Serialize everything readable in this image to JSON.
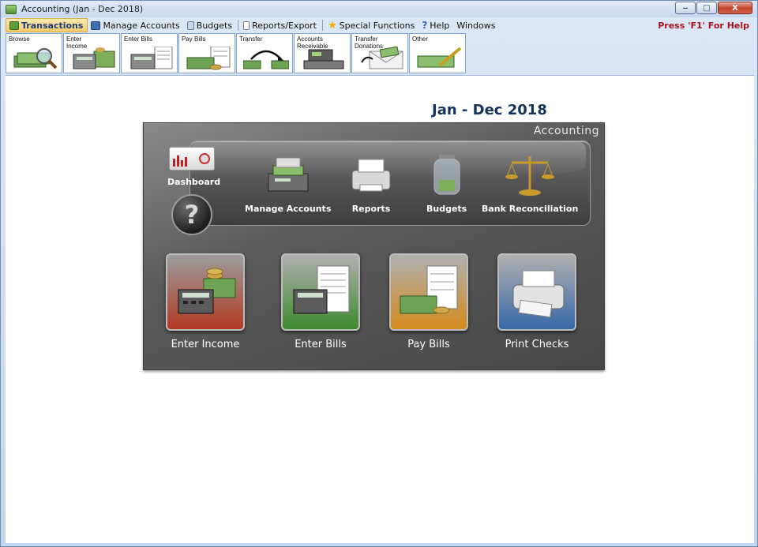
{
  "window": {
    "title": "Accounting (Jan - Dec 2018)",
    "buttons": {
      "minimize": "‒",
      "maximize": "□",
      "close": "X"
    }
  },
  "menubar": {
    "items": [
      {
        "label": "Transactions",
        "icon": "money-icon",
        "active": true
      },
      {
        "label": "Manage Accounts",
        "icon": "accounts-icon"
      },
      {
        "label": "Budgets",
        "icon": "budget-jar-icon"
      },
      {
        "label": "Reports/Export",
        "icon": "report-icon"
      },
      {
        "label": "Special Functions",
        "icon": "star-icon"
      },
      {
        "label": "Help",
        "icon": "help-icon"
      },
      {
        "label": "Windows"
      }
    ],
    "help_hint": "Press 'F1' For Help"
  },
  "toolbar": {
    "buttons": [
      {
        "label": "Browse",
        "icon": "magnifier-money-icon"
      },
      {
        "label": "Enter Income",
        "icon": "calculator-coins-icon"
      },
      {
        "label": "Enter Bills",
        "icon": "calculator-bill-icon"
      },
      {
        "label": "Pay Bills",
        "icon": "bill-money-icon"
      },
      {
        "label": "Transfer",
        "icon": "transfer-arrow-icon"
      },
      {
        "label": "Accounts Receivable",
        "icon": "cash-register-icon"
      },
      {
        "label": "Transfer Donations",
        "icon": "envelope-money-icon"
      },
      {
        "label": "Other",
        "icon": "money-pen-icon"
      }
    ]
  },
  "main": {
    "period": "Jan - Dec 2018",
    "panel": {
      "title": "Accounting",
      "dashboard_label": "Dashboard",
      "help_symbol": "?",
      "shelf_items": [
        {
          "label": "Manage Accounts",
          "icon": "printer-money-icon"
        },
        {
          "label": "Reports",
          "icon": "printer-icon"
        },
        {
          "label": "Budgets",
          "icon": "jar-icon"
        },
        {
          "label": "Bank Reconciliation",
          "icon": "scale-icon"
        }
      ],
      "tiles": [
        {
          "label": "Enter Income",
          "icon": "calculator-coins-icon",
          "color": "#b23a22"
        },
        {
          "label": "Enter Bills",
          "icon": "calculator-bill-icon",
          "color": "#3f8a2e"
        },
        {
          "label": "Pay Bills",
          "icon": "bill-money-icon",
          "color": "#d48b1c"
        },
        {
          "label": "Print Checks",
          "icon": "printer-icon",
          "color": "#3868a8"
        }
      ]
    }
  }
}
